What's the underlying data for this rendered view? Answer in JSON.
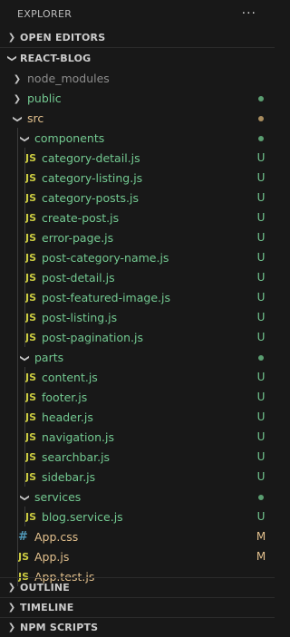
{
  "explorer": {
    "title": "EXPLORER",
    "more_icon": "ellipsis-icon"
  },
  "open_editors": {
    "label": "OPEN EDITORS"
  },
  "project": {
    "label": "REACT-BLOG"
  },
  "tree": [
    {
      "label": "node_modules",
      "kind": "folder",
      "expanded": false,
      "indent": 1,
      "color": "gray",
      "status": ""
    },
    {
      "label": "public",
      "kind": "folder",
      "expanded": false,
      "indent": 1,
      "color": "green",
      "status": "dot-green"
    },
    {
      "label": "src",
      "kind": "folder",
      "expanded": true,
      "indent": 1,
      "color": "orange",
      "status": "dot-orange"
    },
    {
      "label": "components",
      "kind": "folder",
      "expanded": true,
      "indent": 2,
      "color": "green",
      "status": "dot-green"
    },
    {
      "label": "category-detail.js",
      "kind": "js",
      "indent": 3,
      "color": "green",
      "status": "U"
    },
    {
      "label": "category-listing.js",
      "kind": "js",
      "indent": 3,
      "color": "green",
      "status": "U"
    },
    {
      "label": "category-posts.js",
      "kind": "js",
      "indent": 3,
      "color": "green",
      "status": "U"
    },
    {
      "label": "create-post.js",
      "kind": "js",
      "indent": 3,
      "color": "green",
      "status": "U"
    },
    {
      "label": "error-page.js",
      "kind": "js",
      "indent": 3,
      "color": "green",
      "status": "U"
    },
    {
      "label": "post-category-name.js",
      "kind": "js",
      "indent": 3,
      "color": "green",
      "status": "U"
    },
    {
      "label": "post-detail.js",
      "kind": "js",
      "indent": 3,
      "color": "green",
      "status": "U"
    },
    {
      "label": "post-featured-image.js",
      "kind": "js",
      "indent": 3,
      "color": "green",
      "status": "U"
    },
    {
      "label": "post-listing.js",
      "kind": "js",
      "indent": 3,
      "color": "green",
      "status": "U"
    },
    {
      "label": "post-pagination.js",
      "kind": "js",
      "indent": 3,
      "color": "green",
      "status": "U"
    },
    {
      "label": "parts",
      "kind": "folder",
      "expanded": true,
      "indent": 2,
      "color": "green",
      "status": "dot-green"
    },
    {
      "label": "content.js",
      "kind": "js",
      "indent": 3,
      "color": "green",
      "status": "U"
    },
    {
      "label": "footer.js",
      "kind": "js",
      "indent": 3,
      "color": "green",
      "status": "U"
    },
    {
      "label": "header.js",
      "kind": "js",
      "indent": 3,
      "color": "green",
      "status": "U"
    },
    {
      "label": "navigation.js",
      "kind": "js",
      "indent": 3,
      "color": "green",
      "status": "U"
    },
    {
      "label": "searchbar.js",
      "kind": "js",
      "indent": 3,
      "color": "green",
      "status": "U"
    },
    {
      "label": "sidebar.js",
      "kind": "js",
      "indent": 3,
      "color": "green",
      "status": "U"
    },
    {
      "label": "services",
      "kind": "folder",
      "expanded": true,
      "indent": 2,
      "color": "green",
      "status": "dot-green"
    },
    {
      "label": "blog.service.js",
      "kind": "js",
      "indent": 3,
      "color": "green",
      "status": "U"
    },
    {
      "label": "App.css",
      "kind": "css",
      "indent": 2,
      "color": "orange",
      "status": "M"
    },
    {
      "label": "App.js",
      "kind": "js",
      "indent": 2,
      "color": "orange",
      "status": "M"
    },
    {
      "label": "App.test.js",
      "kind": "js",
      "indent": 2,
      "color": "orange",
      "status": ""
    }
  ],
  "sections": [
    {
      "label": "OUTLINE"
    },
    {
      "label": "TIMELINE"
    },
    {
      "label": "NPM SCRIPTS"
    }
  ],
  "colors": {
    "background": "#181818",
    "untracked_green": "#73c991",
    "modified_orange": "#e2c08d",
    "js_icon": "#cbcb41",
    "css_icon": "#519aba"
  }
}
